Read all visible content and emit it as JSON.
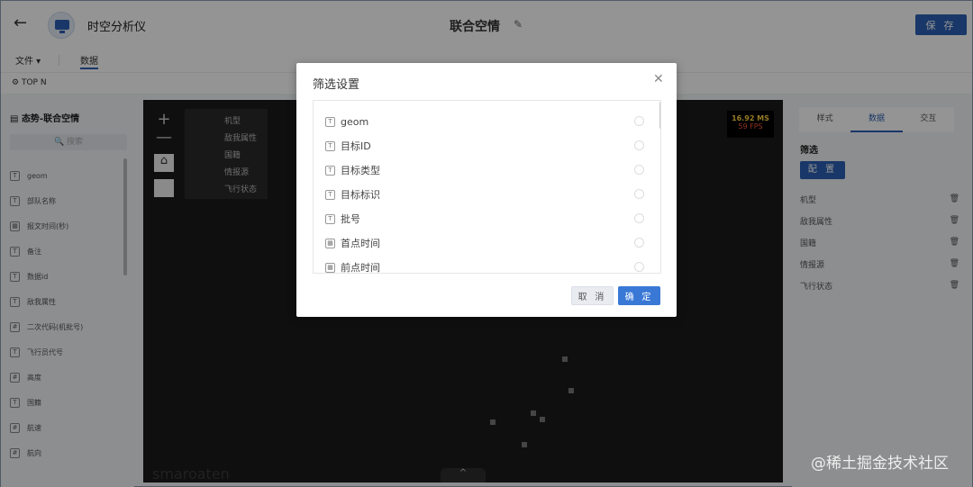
{
  "header": {
    "app_title": "时空分析仪",
    "page_title": "联合空情",
    "save_label": "保 存",
    "back_icon": "arrow-left-icon",
    "edit_icon": "pencil-icon"
  },
  "menubar": {
    "file_label": "文件",
    "data_label": "数据"
  },
  "topn": {
    "label": "TOP N"
  },
  "left_panel": {
    "title": "态势-联合空情",
    "search_placeholder": "搜索",
    "fields": [
      "geom",
      "部队名称",
      "报文时间(秒)",
      "备注",
      "数据id",
      "敌我属性",
      "二次代码(机批号)",
      "飞行员代号",
      "高度",
      "国籍",
      "航速",
      "航向"
    ]
  },
  "map": {
    "fps_ms": "16.92 MS",
    "fps_fps": "59 FPS",
    "legend": [
      "机型",
      "敌我属性",
      "国籍",
      "情报源",
      "飞行状态"
    ],
    "watermark": "smaroaten",
    "tab_glyph": "^"
  },
  "right_panel": {
    "tabs": [
      "样式",
      "数据",
      "交互"
    ],
    "active_tab": "数据",
    "filter_title": "筛选",
    "config_label": "配 置",
    "filters": [
      "机型",
      "敌我属性",
      "国籍",
      "情报源",
      "飞行状态"
    ]
  },
  "dialog": {
    "title": "筛选设置",
    "rows": [
      "geom",
      "目标ID",
      "目标类型",
      "目标标识",
      "批号",
      "首点时间",
      "前点时间"
    ],
    "cancel_label": "取 消",
    "ok_label": "确 定"
  },
  "site_watermark": "@稀土掘金技术社区",
  "colors": {
    "accent": "#2b5fb3",
    "ok_button": "#3a78d6",
    "fps_ms": "#ffd23f",
    "fps_fps": "#ff5a3c"
  }
}
